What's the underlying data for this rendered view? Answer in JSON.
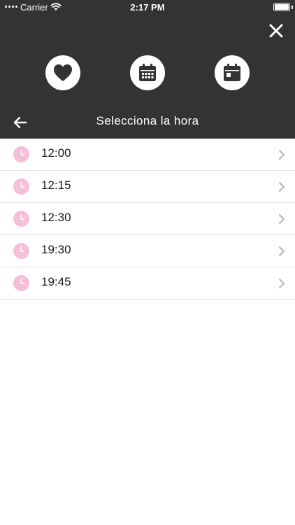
{
  "status_bar": {
    "carrier": "Carrier",
    "time": "2:17 PM"
  },
  "header": {
    "title": "Selecciona la hora",
    "icons": [
      "heart-icon",
      "calendar-icon",
      "calendar-day-icon"
    ],
    "close_icon": "close-icon",
    "back_icon": "back-arrow-icon"
  },
  "times": [
    {
      "label": "12:00"
    },
    {
      "label": "12:15"
    },
    {
      "label": "12:30"
    },
    {
      "label": "19:30"
    },
    {
      "label": "19:45"
    }
  ],
  "colors": {
    "header_bg": "#333333",
    "clock_pink": "#f3bfd9",
    "divider": "#e2e2e2",
    "chevron": "#b5b5b5"
  }
}
